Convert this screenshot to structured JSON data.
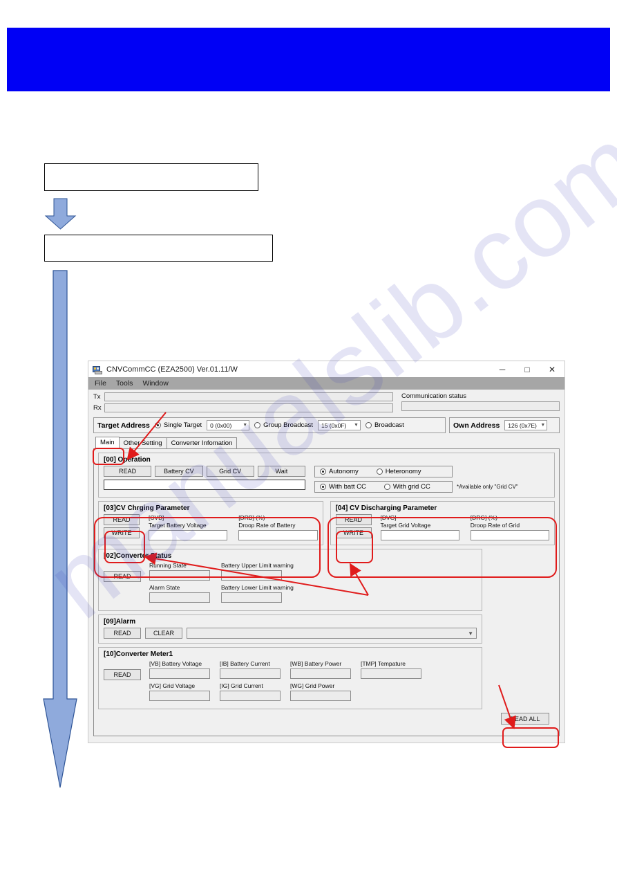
{
  "page": {
    "banner_color": "#0000f5",
    "annotation_color": "#e01b1b",
    "watermark_text": "manualslib.com"
  },
  "callouts": {
    "box1_text": "",
    "box2_text": ""
  },
  "window": {
    "title": "CNVCommCC (EZA2500) Ver.01.11/W",
    "title_icon": "app-icon",
    "controls": {
      "minimize": "─",
      "maximize": "□",
      "close": "✕"
    },
    "menu": [
      {
        "label": "File"
      },
      {
        "label": "Tools"
      },
      {
        "label": "Window"
      }
    ],
    "comm": {
      "tx_label": "Tx",
      "tx_value": "",
      "rx_label": "Rx",
      "rx_value": "",
      "status_label": "Communication status",
      "status_value": ""
    },
    "address": {
      "target_title": "Target Address",
      "single_target_label": "Single Target",
      "single_target_value": "0 (0x00)",
      "group_broadcast_label": "Group Broadcast",
      "group_broadcast_value": "15 (0x0F)",
      "broadcast_label": "Broadcast",
      "own_title": "Own Address",
      "own_value": "126 (0x7E)",
      "selected": "single_target"
    },
    "tabs": [
      {
        "label": "Main",
        "active": true
      },
      {
        "label": "Other Setting",
        "active": false
      },
      {
        "label": "Converter Infomation",
        "active": false
      }
    ],
    "operation": {
      "title": "[00] Operation",
      "buttons": [
        {
          "label": "READ"
        },
        {
          "label": "Battery CV"
        },
        {
          "label": "Grid CV"
        },
        {
          "label": "Wait"
        }
      ],
      "status_value": "",
      "mode_row1": [
        {
          "label": "Autonomy",
          "checked": true
        },
        {
          "label": "Heteronomy",
          "checked": false
        }
      ],
      "mode_row2": [
        {
          "label": "With batt CC",
          "checked": true
        },
        {
          "label": "With grid CC",
          "checked": false
        }
      ],
      "note": "*Available only \"Grid CV\""
    },
    "cv_charging": {
      "title": "[03]CV Chrging Parameter",
      "read_label": "READ",
      "write_label": "WRITE",
      "fields": [
        {
          "code": "[CVB]",
          "name": "Target Battery Voltage",
          "value": ""
        },
        {
          "code": "[DRB] (%)",
          "name": "Droop Rate of Battery",
          "value": ""
        }
      ]
    },
    "cv_discharging": {
      "title": "[04] CV Discharging Parameter",
      "read_label": "READ",
      "write_label": "WRITE",
      "fields": [
        {
          "code": "[DVG]",
          "name": "Target Grid Voltage",
          "value": ""
        },
        {
          "code": "[DRG] (%)",
          "name": "Droop Rate of Grid",
          "value": ""
        }
      ]
    },
    "converter_status": {
      "title": "[02]Converter Status",
      "read_label": "READ",
      "cells": [
        {
          "label": "Running State",
          "value": ""
        },
        {
          "label": "Battery Upper Limit warning",
          "value": ""
        },
        {
          "label": "Alarm State",
          "value": ""
        },
        {
          "label": "Battery Lower Limit warning",
          "value": ""
        }
      ]
    },
    "alarm": {
      "title": "[09]Alarm",
      "read_label": "READ",
      "clear_label": "CLEAR",
      "combo_value": ""
    },
    "converter_meter": {
      "title": "[10]Converter Meter1",
      "read_label": "READ",
      "row1": [
        {
          "label": "[VB] Battery Voltage",
          "value": ""
        },
        {
          "label": "[IB] Battery Current",
          "value": ""
        },
        {
          "label": "[WB] Battery Power",
          "value": ""
        },
        {
          "label": "[TMP] Tempature",
          "value": ""
        }
      ],
      "row2": [
        {
          "label": "[VG] Grid Voltage",
          "value": ""
        },
        {
          "label": "[IG] Grid Current",
          "value": ""
        },
        {
          "label": "[WG] Grid Power",
          "value": ""
        }
      ]
    },
    "read_all_label": "READ ALL"
  }
}
